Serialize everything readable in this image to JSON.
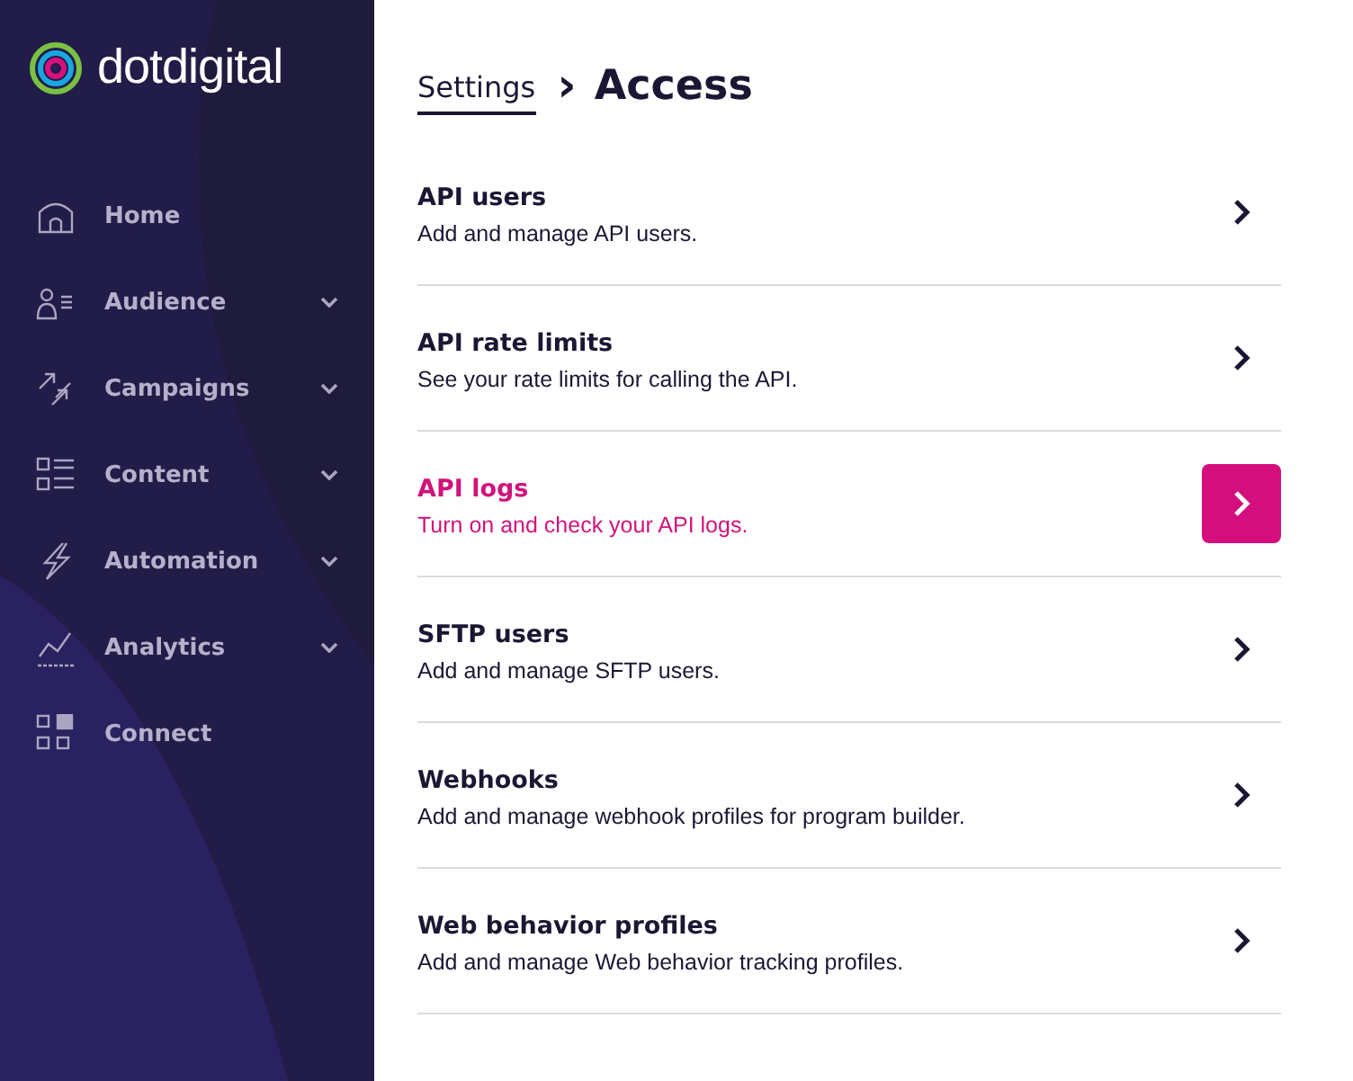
{
  "logo": {
    "text": "dotdigital"
  },
  "nav": [
    {
      "label": "Home",
      "has_submenu": false
    },
    {
      "label": "Audience",
      "has_submenu": true
    },
    {
      "label": "Campaigns",
      "has_submenu": true
    },
    {
      "label": "Content",
      "has_submenu": true
    },
    {
      "label": "Automation",
      "has_submenu": true
    },
    {
      "label": "Analytics",
      "has_submenu": true
    },
    {
      "label": "Connect",
      "has_submenu": false
    }
  ],
  "breadcrumb": {
    "parent": "Settings",
    "separator": "›",
    "current": "Access"
  },
  "items": [
    {
      "title": "API users",
      "description": "Add and manage API users.",
      "selected": false
    },
    {
      "title": "API rate limits",
      "description": "See your rate limits for calling the API.",
      "selected": false
    },
    {
      "title": "API logs",
      "description": "Turn on and check your API logs.",
      "selected": true
    },
    {
      "title": "SFTP users",
      "description": "Add and manage SFTP users.",
      "selected": false
    },
    {
      "title": "Webhooks",
      "description": "Add and manage webhook profiles for program builder.",
      "selected": false
    },
    {
      "title": "Web behavior profiles",
      "description": "Add and manage Web behavior tracking profiles.",
      "selected": false
    }
  ]
}
